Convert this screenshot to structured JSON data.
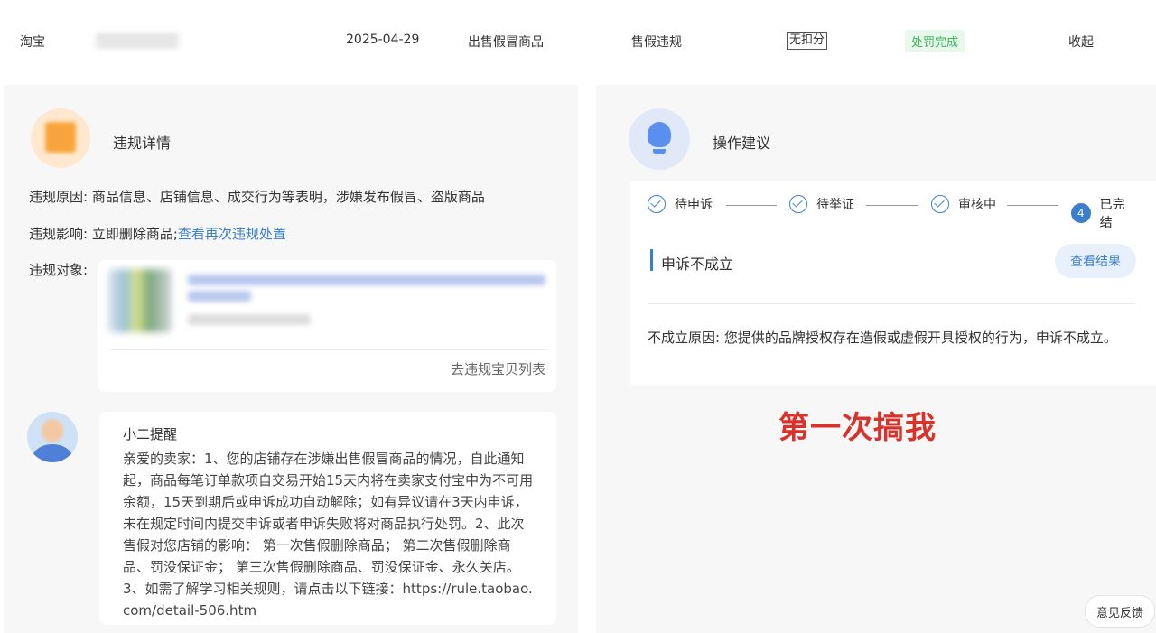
{
  "record": {
    "platform": "淘宝",
    "date": "2025-04-29",
    "violation_type": "出售假冒商品",
    "category": "售假违规",
    "score_tag": "无扣分",
    "status": "处罚完成",
    "collapse": "收起"
  },
  "violation": {
    "title": "违规详情",
    "reason_label": "违规原因:",
    "reason_value": "商品信息、店铺信息、成交行为等表明，涉嫌发布假冒、盗版商品",
    "impact_label": "违规影响:",
    "impact_value": "立即删除商品;",
    "impact_link": "查看再次违规处置",
    "object_label": "违规对象:",
    "object_link": "去违规宝贝列表"
  },
  "reminder": {
    "title": "小二提醒",
    "text": "亲爱的卖家：1、您的店铺存在涉嫌出售假冒商品的情况，自此通知起，商品每笔订单款项自交易开始15天内将在卖家支付宝中为不可用余额，15天到期后或申诉成功自动解除；如有异议请在3天内申诉，未在规定时间内提交申诉或者申诉失败将对商品执行处罚。2、此次售假对您店铺的影响： 第一次售假删除商品； 第二次售假删除商品、罚没保证金； 第三次售假删除商品、罚没保证金、永久关店。 3、如需了解学习相关规则，请点击以下链接：https://rule.taobao.com/detail-506.htm"
  },
  "advice": {
    "title": "操作建议",
    "steps": [
      {
        "label": "待申诉"
      },
      {
        "label": "待举证"
      },
      {
        "label": "审核中"
      },
      {
        "num": "4",
        "label": "已完结"
      }
    ],
    "result_title": "申诉不成立",
    "result_button": "查看结果",
    "reason_label": "不成立原因:",
    "reason_value": "您提供的品牌授权存在造假或虚假开具授权的行为，申诉不成立。"
  },
  "annotation": "第一次搞我",
  "feedback": "意见反馈",
  "colors": {
    "accent": "#3a7fce",
    "success": "#3bb657",
    "warning": "#f7a43a",
    "annotation": "#d9322a"
  }
}
